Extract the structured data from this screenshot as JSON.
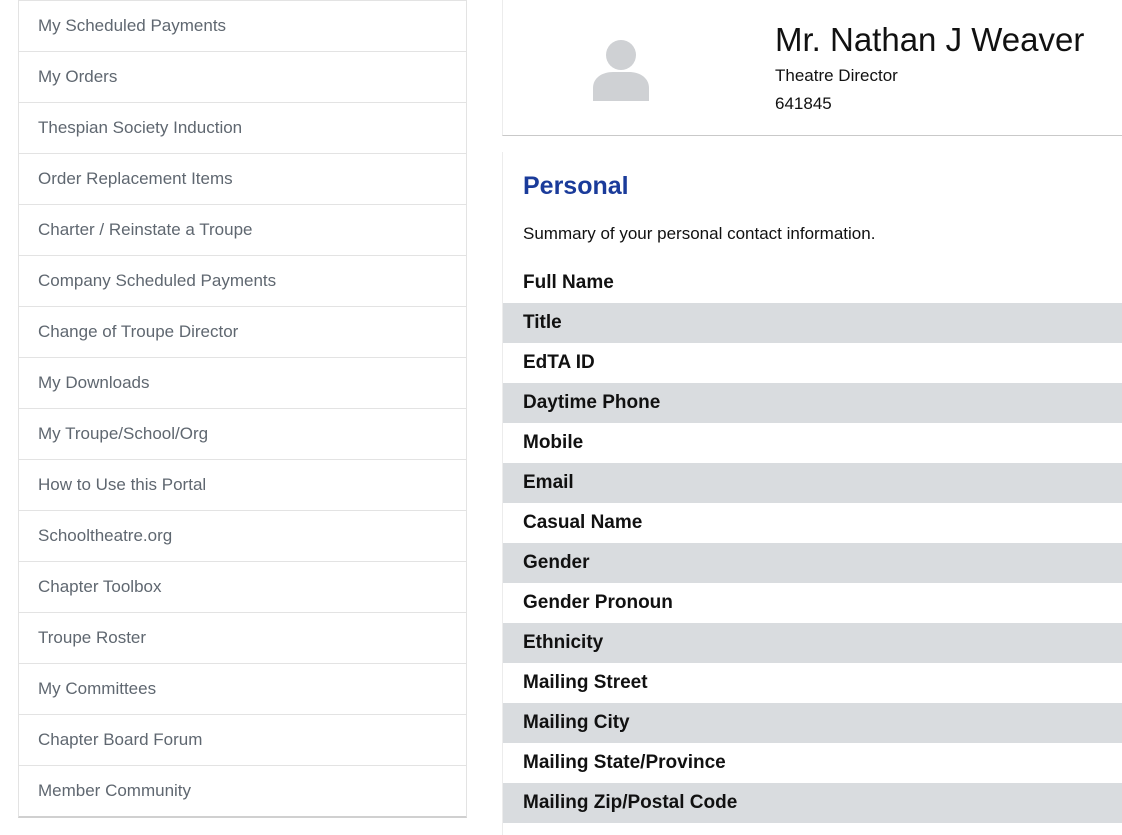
{
  "sidebar": {
    "items": [
      {
        "label": "My Scheduled Payments"
      },
      {
        "label": "My Orders"
      },
      {
        "label": "Thespian Society Induction"
      },
      {
        "label": "Order Replacement Items"
      },
      {
        "label": "Charter / Reinstate a Troupe"
      },
      {
        "label": "Company Scheduled Payments"
      },
      {
        "label": "Change of Troupe Director"
      },
      {
        "label": "My Downloads"
      },
      {
        "label": "My Troupe/School/Org"
      },
      {
        "label": "How to Use this Portal"
      },
      {
        "label": "Schooltheatre.org"
      },
      {
        "label": "Chapter Toolbox"
      },
      {
        "label": "Troupe Roster"
      },
      {
        "label": "My Committees"
      },
      {
        "label": "Chapter Board Forum"
      },
      {
        "label": "Member Community"
      }
    ]
  },
  "profile": {
    "name": "Mr. Nathan J Weaver",
    "title": "Theatre Director",
    "id": "641845",
    "avatar_icon": "user-silhouette-icon"
  },
  "personal": {
    "heading": "Personal",
    "description": "Summary of your personal contact information.",
    "fields": [
      {
        "label": "Full Name"
      },
      {
        "label": "Title"
      },
      {
        "label": "EdTA ID"
      },
      {
        "label": "Daytime Phone"
      },
      {
        "label": "Mobile"
      },
      {
        "label": "Email"
      },
      {
        "label": "Casual Name"
      },
      {
        "label": "Gender"
      },
      {
        "label": "Gender Pronoun"
      },
      {
        "label": "Ethnicity"
      },
      {
        "label": "Mailing Street"
      },
      {
        "label": "Mailing City"
      },
      {
        "label": "Mailing State/Province"
      },
      {
        "label": "Mailing Zip/Postal Code"
      }
    ]
  },
  "colors": {
    "link_gray": "#5f6770",
    "heading_blue": "#1a3b9a",
    "row_alt": "#d9dcdf"
  }
}
